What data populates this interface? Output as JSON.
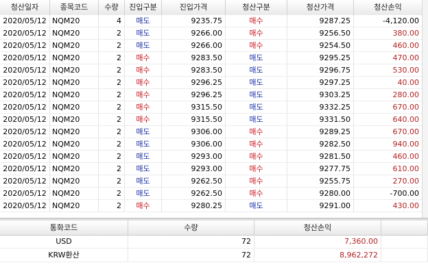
{
  "headers": [
    "청산일자",
    "종목코드",
    "수량",
    "진입구분",
    "진입가격",
    "청산구분",
    "청산가격",
    "청산손익"
  ],
  "rows": [
    {
      "date": "2020/05/12",
      "code": "NQM20",
      "qty": "4",
      "entry_type": "매도",
      "entry_price": "9235.75",
      "exit_type": "매수",
      "exit_price": "9287.25",
      "pnl": "-4,120.00"
    },
    {
      "date": "2020/05/12",
      "code": "NQM20",
      "qty": "2",
      "entry_type": "매도",
      "entry_price": "9266.00",
      "exit_type": "매수",
      "exit_price": "9256.50",
      "pnl": "380.00"
    },
    {
      "date": "2020/05/12",
      "code": "NQM20",
      "qty": "2",
      "entry_type": "매도",
      "entry_price": "9266.00",
      "exit_type": "매수",
      "exit_price": "9254.50",
      "pnl": "460.00"
    },
    {
      "date": "2020/05/12",
      "code": "NQM20",
      "qty": "2",
      "entry_type": "매수",
      "entry_price": "9283.50",
      "exit_type": "매도",
      "exit_price": "9295.25",
      "pnl": "470.00"
    },
    {
      "date": "2020/05/12",
      "code": "NQM20",
      "qty": "2",
      "entry_type": "매수",
      "entry_price": "9283.50",
      "exit_type": "매도",
      "exit_price": "9296.75",
      "pnl": "530.00"
    },
    {
      "date": "2020/05/12",
      "code": "NQM20",
      "qty": "2",
      "entry_type": "매수",
      "entry_price": "9296.25",
      "exit_type": "매도",
      "exit_price": "9297.25",
      "pnl": "40.00"
    },
    {
      "date": "2020/05/12",
      "code": "NQM20",
      "qty": "2",
      "entry_type": "매수",
      "entry_price": "9296.25",
      "exit_type": "매도",
      "exit_price": "9303.25",
      "pnl": "280.00"
    },
    {
      "date": "2020/05/12",
      "code": "NQM20",
      "qty": "2",
      "entry_type": "매수",
      "entry_price": "9315.50",
      "exit_type": "매도",
      "exit_price": "9332.25",
      "pnl": "670.00"
    },
    {
      "date": "2020/05/12",
      "code": "NQM20",
      "qty": "2",
      "entry_type": "매수",
      "entry_price": "9315.50",
      "exit_type": "매도",
      "exit_price": "9331.50",
      "pnl": "640.00"
    },
    {
      "date": "2020/05/12",
      "code": "NQM20",
      "qty": "2",
      "entry_type": "매도",
      "entry_price": "9306.00",
      "exit_type": "매수",
      "exit_price": "9289.25",
      "pnl": "670.00"
    },
    {
      "date": "2020/05/12",
      "code": "NQM20",
      "qty": "2",
      "entry_type": "매도",
      "entry_price": "9306.00",
      "exit_type": "매수",
      "exit_price": "9282.50",
      "pnl": "940.00"
    },
    {
      "date": "2020/05/12",
      "code": "NQM20",
      "qty": "2",
      "entry_type": "매도",
      "entry_price": "9293.00",
      "exit_type": "매수",
      "exit_price": "9281.50",
      "pnl": "460.00"
    },
    {
      "date": "2020/05/12",
      "code": "NQM20",
      "qty": "2",
      "entry_type": "매도",
      "entry_price": "9293.00",
      "exit_type": "매수",
      "exit_price": "9277.75",
      "pnl": "610.00"
    },
    {
      "date": "2020/05/12",
      "code": "NQM20",
      "qty": "2",
      "entry_type": "매도",
      "entry_price": "9262.50",
      "exit_type": "매수",
      "exit_price": "9255.75",
      "pnl": "270.00"
    },
    {
      "date": "2020/05/12",
      "code": "NQM20",
      "qty": "2",
      "entry_type": "매도",
      "entry_price": "9262.50",
      "exit_type": "매수",
      "exit_price": "9280.00",
      "pnl": "-700.00"
    },
    {
      "date": "2020/05/12",
      "code": "NQM20",
      "qty": "2",
      "entry_type": "매수",
      "entry_price": "9280.25",
      "exit_type": "매도",
      "exit_price": "9291.00",
      "pnl": "430.00"
    }
  ],
  "summary": {
    "headers": [
      "통화코드",
      "수량",
      "청산손익"
    ],
    "rows": [
      {
        "currency": "USD",
        "qty": "72",
        "pnl": "7,360.00"
      },
      {
        "currency": "KRW환산",
        "qty": "72",
        "pnl": "8,962,272"
      }
    ]
  },
  "colors": {
    "buy": "#c8141e",
    "sell": "#1a2fa8",
    "profit": "#b22222",
    "loss": "#000000"
  }
}
